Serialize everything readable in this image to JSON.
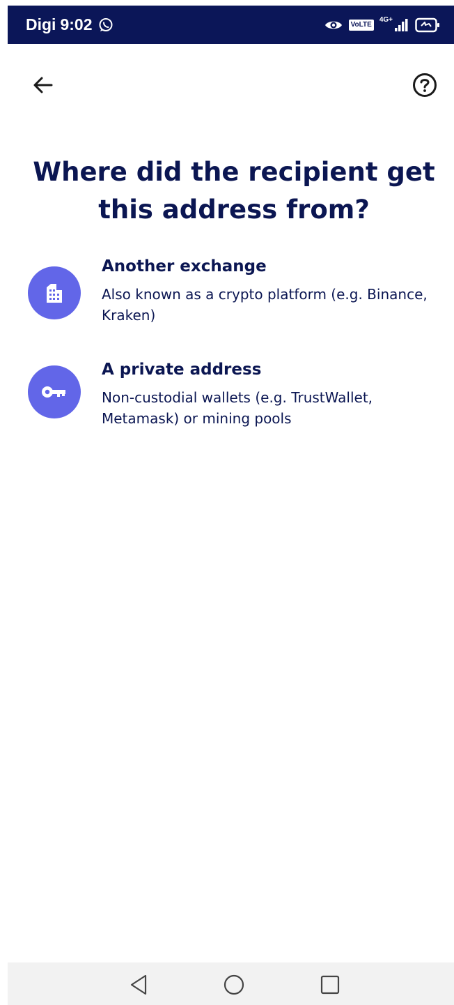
{
  "status_bar": {
    "carrier": "Digi",
    "time": "9:02",
    "volte_label": "VoLTE",
    "network_label": "4G+",
    "icons": [
      "whatsapp-icon",
      "eye-icon",
      "volte-icon",
      "signal-icon",
      "battery-charging-icon"
    ]
  },
  "header": {
    "back_icon": "arrow-left-icon",
    "help_icon": "question-circle-icon"
  },
  "main": {
    "title": "Where did the recipient get this address from?",
    "options": [
      {
        "icon": "building-icon",
        "title": "Another exchange",
        "description": "Also known as a crypto platform (e.g. Binance, Kraken)"
      },
      {
        "icon": "key-icon",
        "title": "A private address",
        "description": "Non-custodial wallets (e.g. TrustWallet, Metamask) or mining pools"
      }
    ]
  },
  "navigation_bar": {
    "icons": [
      "nav-back-icon",
      "nav-home-icon",
      "nav-recents-icon"
    ]
  },
  "colors": {
    "status_bar_bg": "#0b1658",
    "text_primary": "#0b1652",
    "icon_circle": "#6266e8",
    "nav_bar_bg": "#f2f2f2"
  }
}
